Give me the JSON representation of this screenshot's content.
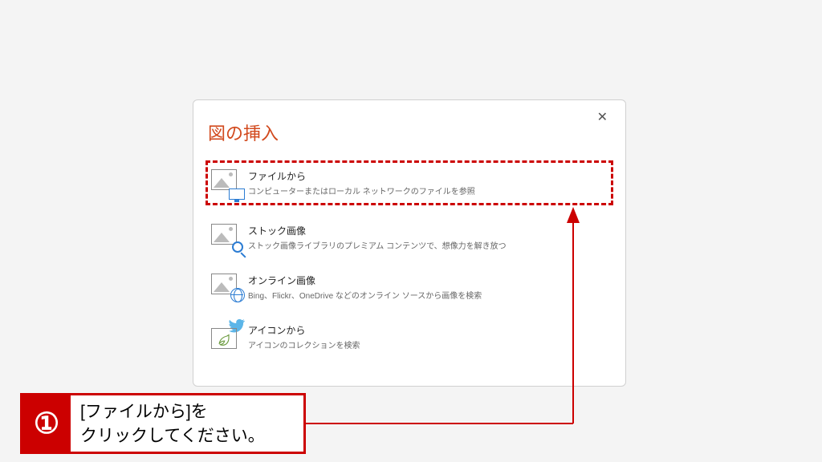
{
  "dialog": {
    "title": "図の挿入",
    "options": [
      {
        "title": "ファイルから",
        "desc": "コンピューターまたはローカル ネットワークのファイルを参照"
      },
      {
        "title": "ストック画像",
        "desc": "ストック画像ライブラリのプレミアム コンテンツで、想像力を解き放つ"
      },
      {
        "title": "オンライン画像",
        "desc": "Bing、Flickr、OneDrive などのオンライン ソースから画像を検索"
      },
      {
        "title": "アイコンから",
        "desc": "アイコンのコレクションを検索"
      }
    ]
  },
  "callout": {
    "number": "①",
    "text": "[ファイルから]を\nクリックしてください。"
  },
  "colors": {
    "highlight": "#c00",
    "accent_title": "#d24a1e",
    "icon_blue": "#2b7cd3"
  }
}
